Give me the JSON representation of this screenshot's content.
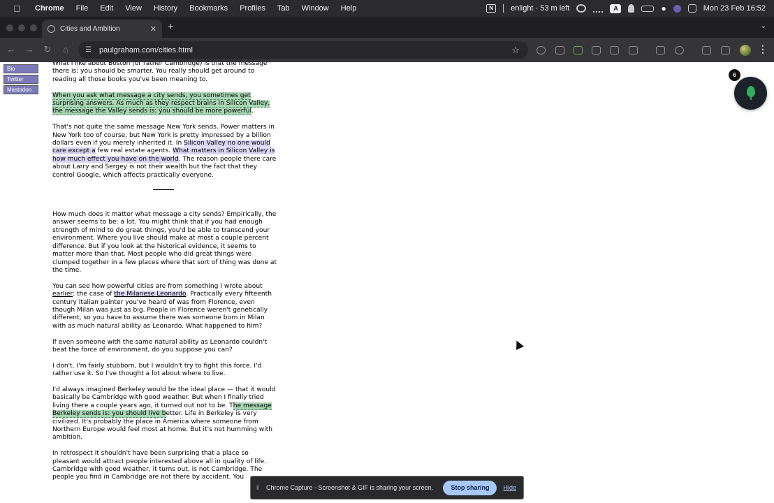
{
  "menubar": {
    "app": "Chrome",
    "items": [
      "File",
      "Edit",
      "View",
      "History",
      "Bookmarks",
      "Profiles",
      "Tab",
      "Window",
      "Help"
    ],
    "status_text": "enlight · 53 m left",
    "datetime": "Mon 23 Feb  16:52"
  },
  "tab": {
    "title": "Cities and Ambition"
  },
  "toolbar": {
    "url": "paulgraham.com/cities.html"
  },
  "sidebar": {
    "links": [
      "Bio",
      "Twitter",
      "Mastodon"
    ]
  },
  "article": {
    "p1": "What I like about Boston (or rather Cambridge) is that the message there is: you should be smarter. You really should get around to reading all those books you've been meaning to.",
    "p2": "When you ask what message a city sends, you sometimes get surprising answers. As much as they respect brains in Silicon Valley, the message the Valley sends is: you should be more powerful",
    "p2_end": ".",
    "p3_a": "That's not quite the same message New York sends. Power matters in New York too of course, but New York is pretty impressed by a billion dollars even if you merely inherited it. In ",
    "p3_hl1": "Silicon Valley no one would care except a",
    "p3_b": " few real estate agents. ",
    "p3_hl2": "What matters in Silicon Valley is how much effect you have on the world",
    "p3_c": ". The reason people there care about Larry and Sergey is not their wealth but the fact that they control Google, which affects practically everyone.",
    "p4": "How much does it matter what message a city sends? Empirically, the answer seems to be: a lot. You might think that if you had enough strength of mind to do great things, you'd be able to transcend your environment. Where you live should make at most a couple percent difference. But if you look at the historical evidence, it seems to matter more than that. Most people who did great things were clumped together in a few places where that sort of thing was done at the time.",
    "p5_a": "You can see how powerful cities are from something I wrote about ",
    "p5_link": "earlier",
    "p5_b": ": the case of ",
    "p5_hl": "the Milanese Leonardo",
    "p5_c": ". Practically every fifteenth century Italian painter you've heard of was from Florence, even though Milan was just as big. People in Florence weren't genetically different, so you have to assume there was someone born in Milan with as much natural ability as Leonardo. What happened to him?",
    "p6": "If even someone with the same natural ability as Leonardo couldn't beat the force of environment, do you suppose you can?",
    "p7": "I don't. I'm fairly stubborn, but I wouldn't try to fight this force. I'd rather use it. So I've thought a lot about where to live.",
    "p8_a": "I'd always imagined Berkeley would be the ideal place — that it would basically be Cambridge with good weather. But when I finally tried living there a couple years ago, it turned out not to be. T",
    "p8_hl": "he message Berkeley sends is: you should live b",
    "p8_b": "etter. Life in Berkeley is very civilized. It's probably the place in America where someone from Northern Europe would feel most at home. But it's not humming with ambition.",
    "p9": "In retrospect it shouldn't have been surprising that a place so pleasant would attract people interested above all in quality of life. Cambridge with good weather, it turns out, is not Cambridge. The people you find in Cambridge are not there by accident. You"
  },
  "floating": {
    "badge_count": "6"
  },
  "sharebar": {
    "message": "Chrome Capture - Screenshot & GIF is sharing your screen.",
    "stop_label": "Stop sharing",
    "hide_label": "Hide"
  }
}
